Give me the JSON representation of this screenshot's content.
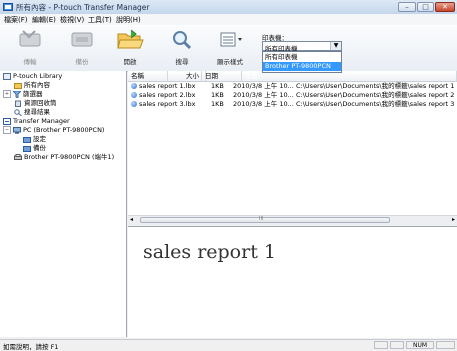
{
  "window": {
    "title": "所有內容 - P-touch Transfer Manager",
    "minimize": "–",
    "maximize": "□",
    "close": "✕"
  },
  "menu": [
    "檔案(F)",
    "編輯(E)",
    "檢視(V)",
    "工具(T)",
    "說明(H)"
  ],
  "toolbar": {
    "transfer": "傳輸",
    "backup": "備份",
    "open": "開啟",
    "search": "搜尋",
    "display_style": "顯示樣式",
    "printer_label": "印表機：",
    "printer_value": "所有印表機",
    "printer_options": [
      "所有印表機",
      "Brother PT-9800PCN"
    ]
  },
  "tree": {
    "items": [
      {
        "label": "P-touch Library",
        "level": 0
      },
      {
        "label": "所有內容",
        "level": 1
      },
      {
        "label": "篩選器",
        "level": 1
      },
      {
        "label": "資源回收筒",
        "level": 1
      },
      {
        "label": "搜尋結果",
        "level": 1
      },
      {
        "label": "Transfer Manager",
        "level": 0
      },
      {
        "label": "PC (Brother PT-9800PCN)",
        "level": 1
      },
      {
        "label": "設定",
        "level": 2
      },
      {
        "label": "備份",
        "level": 2
      },
      {
        "label": "Brother PT-9800PCN (端牛1)",
        "level": 1
      }
    ]
  },
  "list": {
    "columns": [
      "名稱",
      "大小",
      "日期",
      "位置"
    ],
    "rows": [
      {
        "name": "sales report 1.lbx",
        "size": "1KB",
        "date": "2010/3/8 上午 10...",
        "location": "C:\\Users\\User\\Documents\\我的標籤\\sales report 1"
      },
      {
        "name": "sales report 2.lbx",
        "size": "1KB",
        "date": "2010/3/8 上午 10...",
        "location": "C:\\Users\\User\\Documents\\我的標籤\\sales report 2"
      },
      {
        "name": "sales report 3.lbx",
        "size": "1KB",
        "date": "2010/3/8 上午 10...",
        "location": "C:\\Users\\User\\Documents\\我的標籤\\sales report 3"
      }
    ],
    "scroll_mark": "III"
  },
  "preview": {
    "text": "sales report 1"
  },
  "status": {
    "help": "如需說明，請按 F1",
    "num": "NUM"
  }
}
